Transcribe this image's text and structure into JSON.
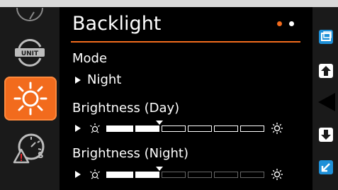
{
  "header": {
    "title": "Backlight"
  },
  "pager": {
    "dots": [
      "#f26b1d",
      "#ffffff"
    ]
  },
  "colors": {
    "accent": "#f26b1d",
    "rail": "#1a1a1a",
    "background": "#000000"
  },
  "mode": {
    "label": "Mode",
    "value": "Night"
  },
  "brightness_day": {
    "label": "Brightness (Day)",
    "level": 0.3333,
    "segments": 6
  },
  "brightness_night": {
    "label": "Brightness (Night)",
    "level": 0.3333,
    "segments": 6
  },
  "left_rail": {
    "items": [
      {
        "icon": "gauge-partial-icon"
      },
      {
        "icon": "unit-sync-icon",
        "text": "UNIT"
      },
      {
        "icon": "sun-icon",
        "selected": true
      },
      {
        "icon": "warning-gauge-icon"
      }
    ]
  },
  "right_rail": {
    "buttons": [
      {
        "icon": "window-icon"
      },
      {
        "icon": "up-arrow-icon"
      },
      {
        "icon": "left-arrow-icon"
      },
      {
        "icon": "down-arrow-icon"
      },
      {
        "icon": "back-icon"
      }
    ]
  }
}
